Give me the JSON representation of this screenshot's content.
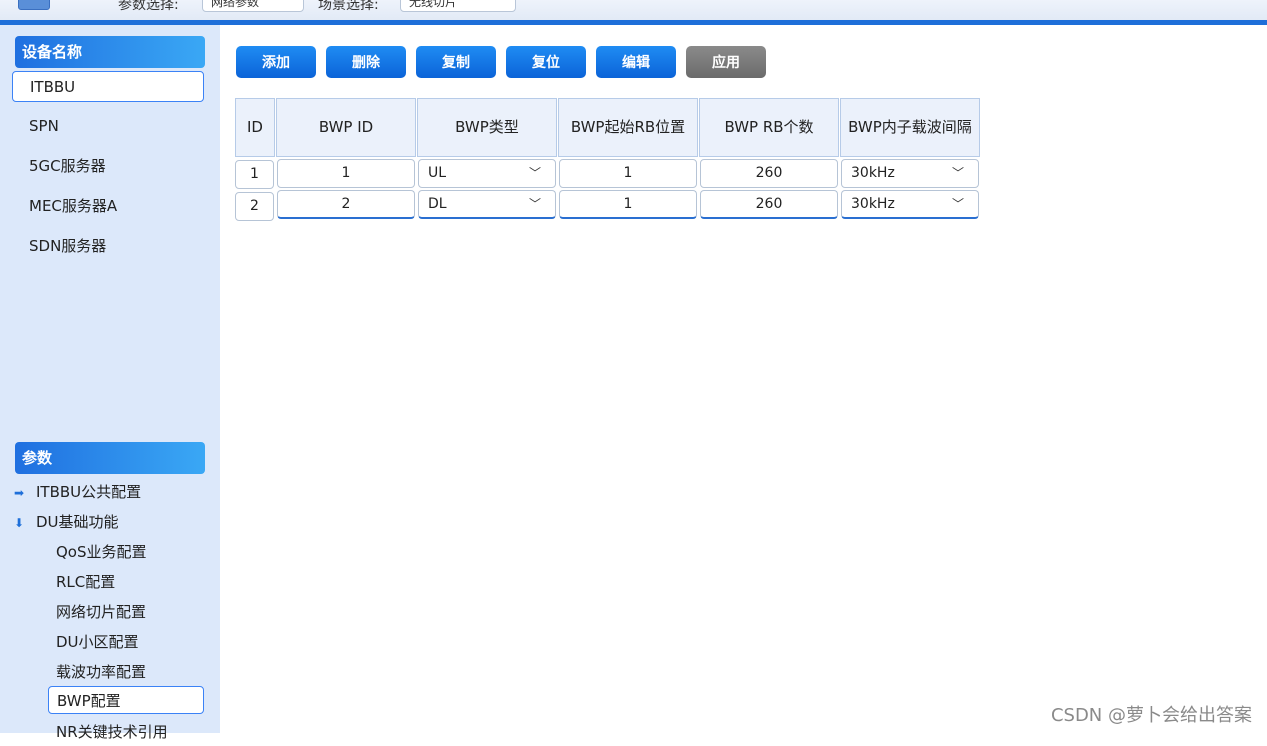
{
  "top": {
    "labels": [
      "参数选择:",
      "场景选择:"
    ],
    "selects": [
      "网络参数",
      "无线切片"
    ]
  },
  "device_panel": {
    "header": "设备名称",
    "items": [
      "ITBBU",
      "SPN",
      "5GC服务器",
      "MEC服务器A",
      "SDN服务器"
    ],
    "selected": "ITBBU"
  },
  "params_panel": {
    "header": "参数",
    "nodes": [
      {
        "label": "ITBBU公共配置",
        "icon": "arrow-right-icon"
      },
      {
        "label": "DU基础功能",
        "icon": "arrow-down-icon"
      }
    ],
    "children": [
      "QoS业务配置",
      "RLC配置",
      "网络切片配置",
      "DU小区配置",
      "载波功率配置",
      "BWP配置",
      "NR关键技术引用"
    ],
    "selected": "BWP配置"
  },
  "toolbar": {
    "add": "添加",
    "delete": "删除",
    "copy": "复制",
    "reset": "复位",
    "edit": "编辑",
    "apply": "应用"
  },
  "table": {
    "columns": [
      "ID",
      "BWP ID",
      "BWP类型",
      "BWP起始RB位置",
      "BWP RB个数",
      "BWP内子载波间隔"
    ],
    "rows": [
      {
        "id": "1",
        "bwp_id": "1",
        "type": "UL",
        "start_rb": "1",
        "rb_count": "260",
        "scs": "30kHz"
      },
      {
        "id": "2",
        "bwp_id": "2",
        "type": "DL",
        "start_rb": "1",
        "rb_count": "260",
        "scs": "30kHz"
      }
    ]
  },
  "watermark": "CSDN @萝卜会给出答案",
  "colors": {
    "accent": "#1e6fd9",
    "sidebar_bg": "#dce8fa",
    "button_disabled": "#777777"
  }
}
